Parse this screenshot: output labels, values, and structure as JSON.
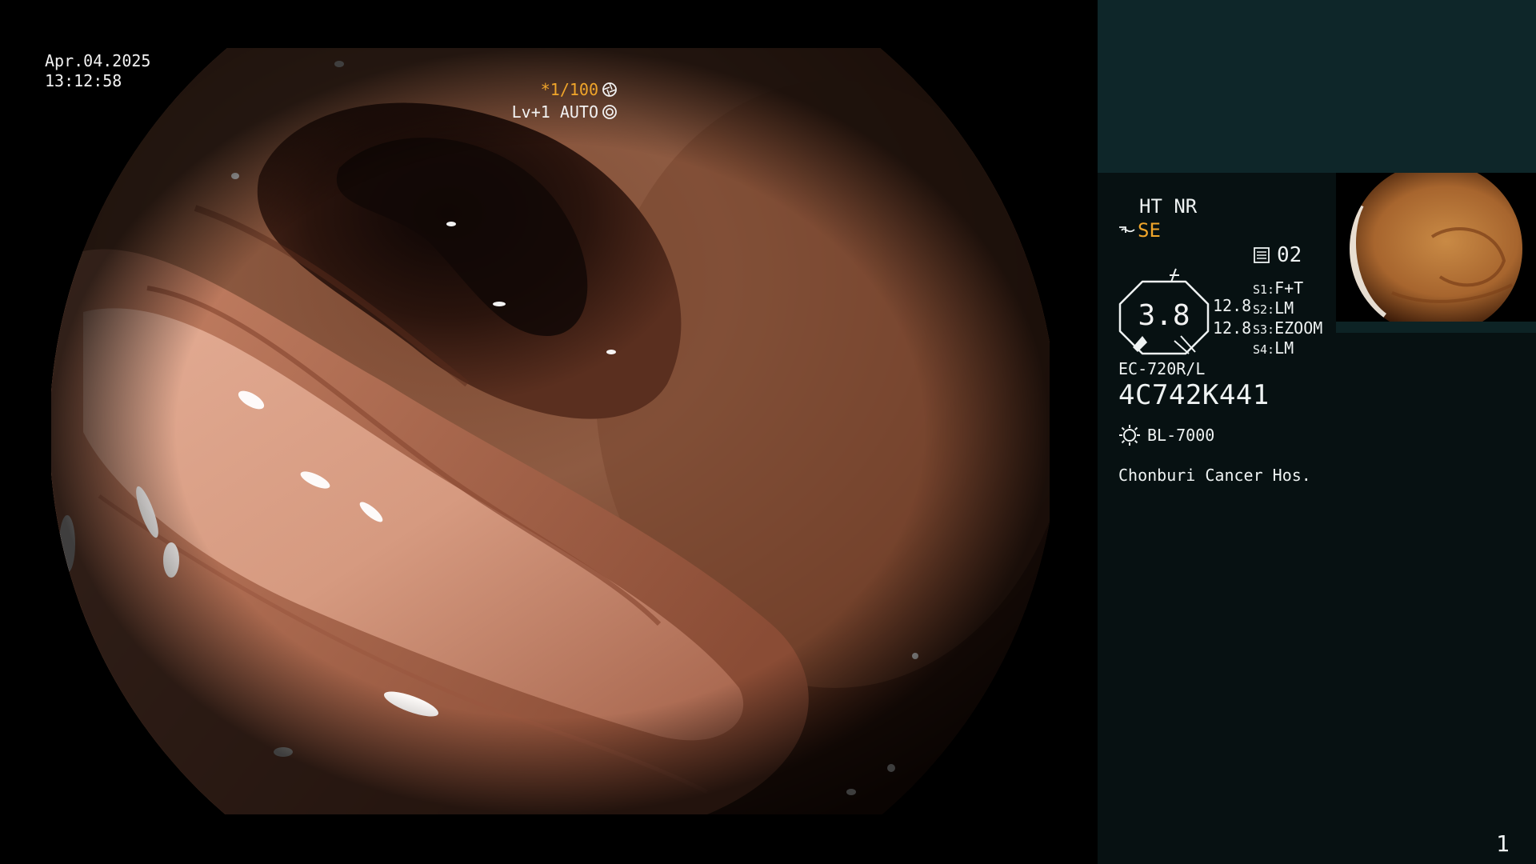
{
  "osd": {
    "date": "Apr.04.2025",
    "time": "13:12:58",
    "shutter": "*1/100",
    "shutter_icon": "aperture-icon",
    "level": "Lv+1 AUTO",
    "level_icon": "iris-icon"
  },
  "panel": {
    "modes": "HT NR",
    "structure_enhance": "SE",
    "structure_icon": "structure-enhance-icon",
    "enhance_icon": "enhance-icon",
    "memory_icon": "memory-card-icon",
    "memory_value": "02",
    "gauge_value": "3.8",
    "gauge_top": "12.8",
    "gauge_bottom": "12.8",
    "switches": [
      {
        "key": "S1:",
        "value": "F+T"
      },
      {
        "key": "S2:",
        "value": "LM"
      },
      {
        "key": "S3:",
        "value": "EZOOM"
      },
      {
        "key": "S4:",
        "value": "LM"
      }
    ],
    "scope_model": "EC-720R/L",
    "scope_serial": "4C742K441",
    "light_source": "BL-7000",
    "light_icon": "lamp-icon",
    "hospital": "Chonburi Cancer Hos.",
    "page_number": "1"
  },
  "colors": {
    "osd_accent": "#f0a52a",
    "panel_bg": "#071112",
    "panel_top_bg": "#0e2629"
  }
}
